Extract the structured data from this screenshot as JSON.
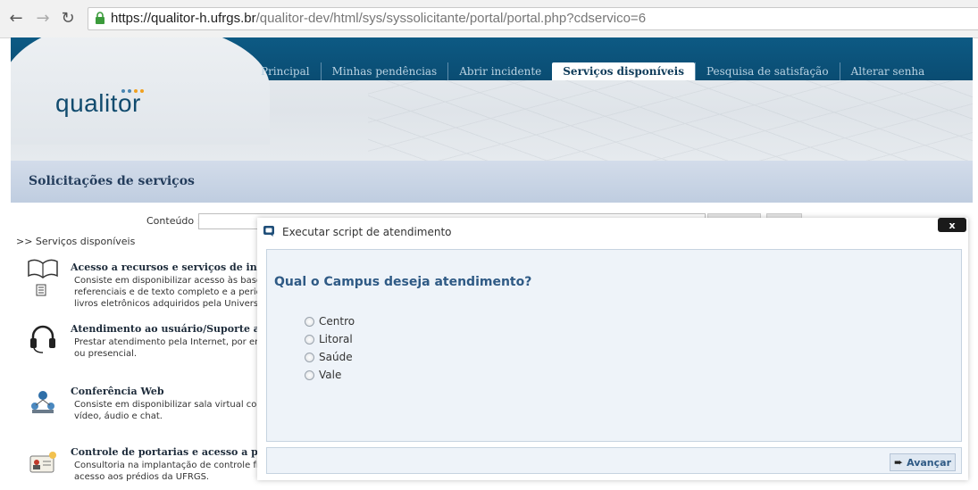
{
  "browser": {
    "url_main": "https://qualitor-h.ufrgs.br",
    "url_path": "/qualitor-dev/html/sys/syssolicitante/portal/portal.php?cdservico=6",
    "back_icon": "back-arrow-icon",
    "forward_icon": "forward-arrow-icon",
    "reload_icon": "reload-icon",
    "lock_icon": "lock-icon"
  },
  "header": {
    "logo_text": "qualitor",
    "nav": [
      {
        "label": "Principal",
        "active": false
      },
      {
        "label": "Minhas pendências",
        "active": false
      },
      {
        "label": "Abrir incidente",
        "active": false
      },
      {
        "label": "Serviços disponíveis",
        "active": true
      },
      {
        "label": "Pesquisa de satisfação",
        "active": false
      },
      {
        "label": "Alterar senha",
        "active": false
      }
    ]
  },
  "page": {
    "title": "Solicitações de serviços",
    "search_label": "Conteúdo :",
    "breadcrumb": ">> Serviços disponíveis"
  },
  "services": [
    {
      "title": "Acesso a recursos e serviços de infor",
      "desc": "Consiste em disponibilizar acesso às bases\nreferenciais e de texto completo e a periód\nlivros eletrônicos adquiridos pela Universi",
      "icon": "book-icon"
    },
    {
      "title": "Atendimento ao usuário/Suporte ao u",
      "desc": "Prestar atendimento pela Internet, por em\nou presencial.",
      "icon": "headset-icon"
    },
    {
      "title": "Conferência Web",
      "desc": "Consiste em disponibilizar sala virtual com\nvídeo, áudio e chat.",
      "icon": "network-icon"
    },
    {
      "title": "Controle de portarias e acesso a préd",
      "desc": "Consultoria na implantação de controle fís\nacesso aos prédios da UFRGS.",
      "icon": "id-card-icon"
    }
  ],
  "modal": {
    "title": "Executar script de atendimento",
    "close_label": "x",
    "question": "Qual o Campus deseja atendimento?",
    "options": [
      "Centro",
      "Litoral",
      "Saúde",
      "Vale"
    ],
    "next_label": "Avançar"
  }
}
